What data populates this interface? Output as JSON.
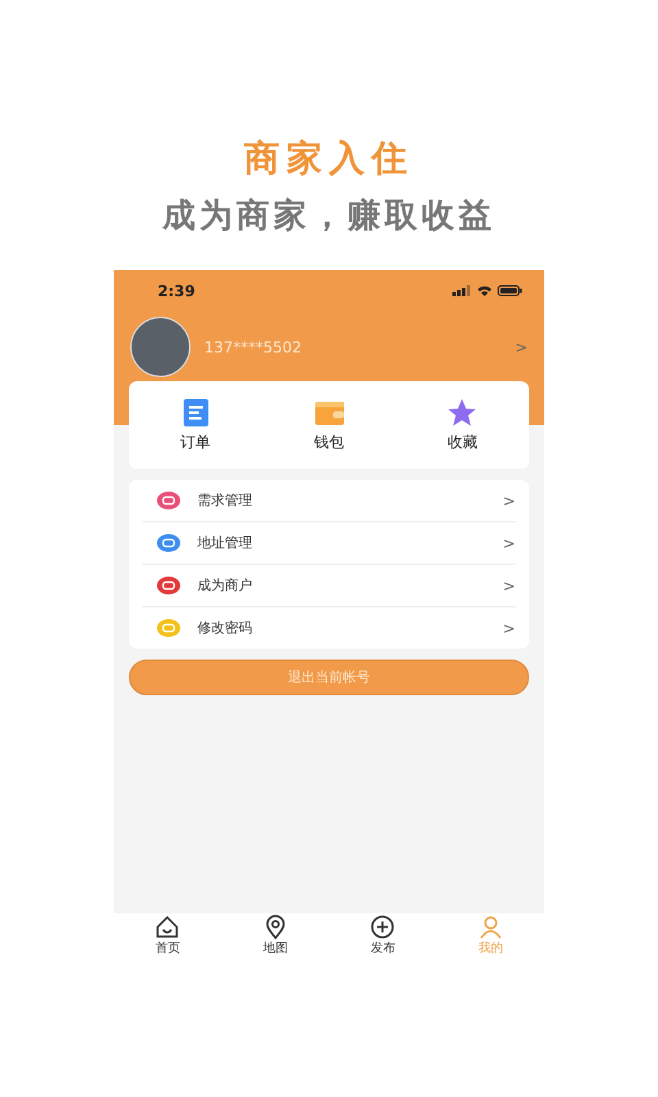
{
  "promo": {
    "headline": "商家入住",
    "subtitle": "成为商家，赚取收益"
  },
  "status_bar": {
    "time": "2:39"
  },
  "profile": {
    "phone": "137****5502",
    "chevron": ">"
  },
  "shortcuts": [
    {
      "kind": "order",
      "label": "订单"
    },
    {
      "kind": "wallet",
      "label": "钱包"
    },
    {
      "kind": "favorite",
      "label": "收藏"
    }
  ],
  "menu": [
    {
      "label": "需求管理",
      "color": "#e8507a",
      "chevron": ">"
    },
    {
      "label": "地址管理",
      "color": "#3d8ef0",
      "chevron": ">"
    },
    {
      "label": "成为商户",
      "color": "#e23a3a",
      "chevron": ">"
    },
    {
      "label": "修改密码",
      "color": "#f2c21a",
      "chevron": ">"
    }
  ],
  "logout": "退出当前帐号",
  "tabs": [
    {
      "kind": "home",
      "label": "首页",
      "selected": false
    },
    {
      "kind": "map",
      "label": "地图",
      "selected": false
    },
    {
      "kind": "post",
      "label": "发布",
      "selected": false
    },
    {
      "kind": "me",
      "label": "我的",
      "selected": true
    }
  ]
}
